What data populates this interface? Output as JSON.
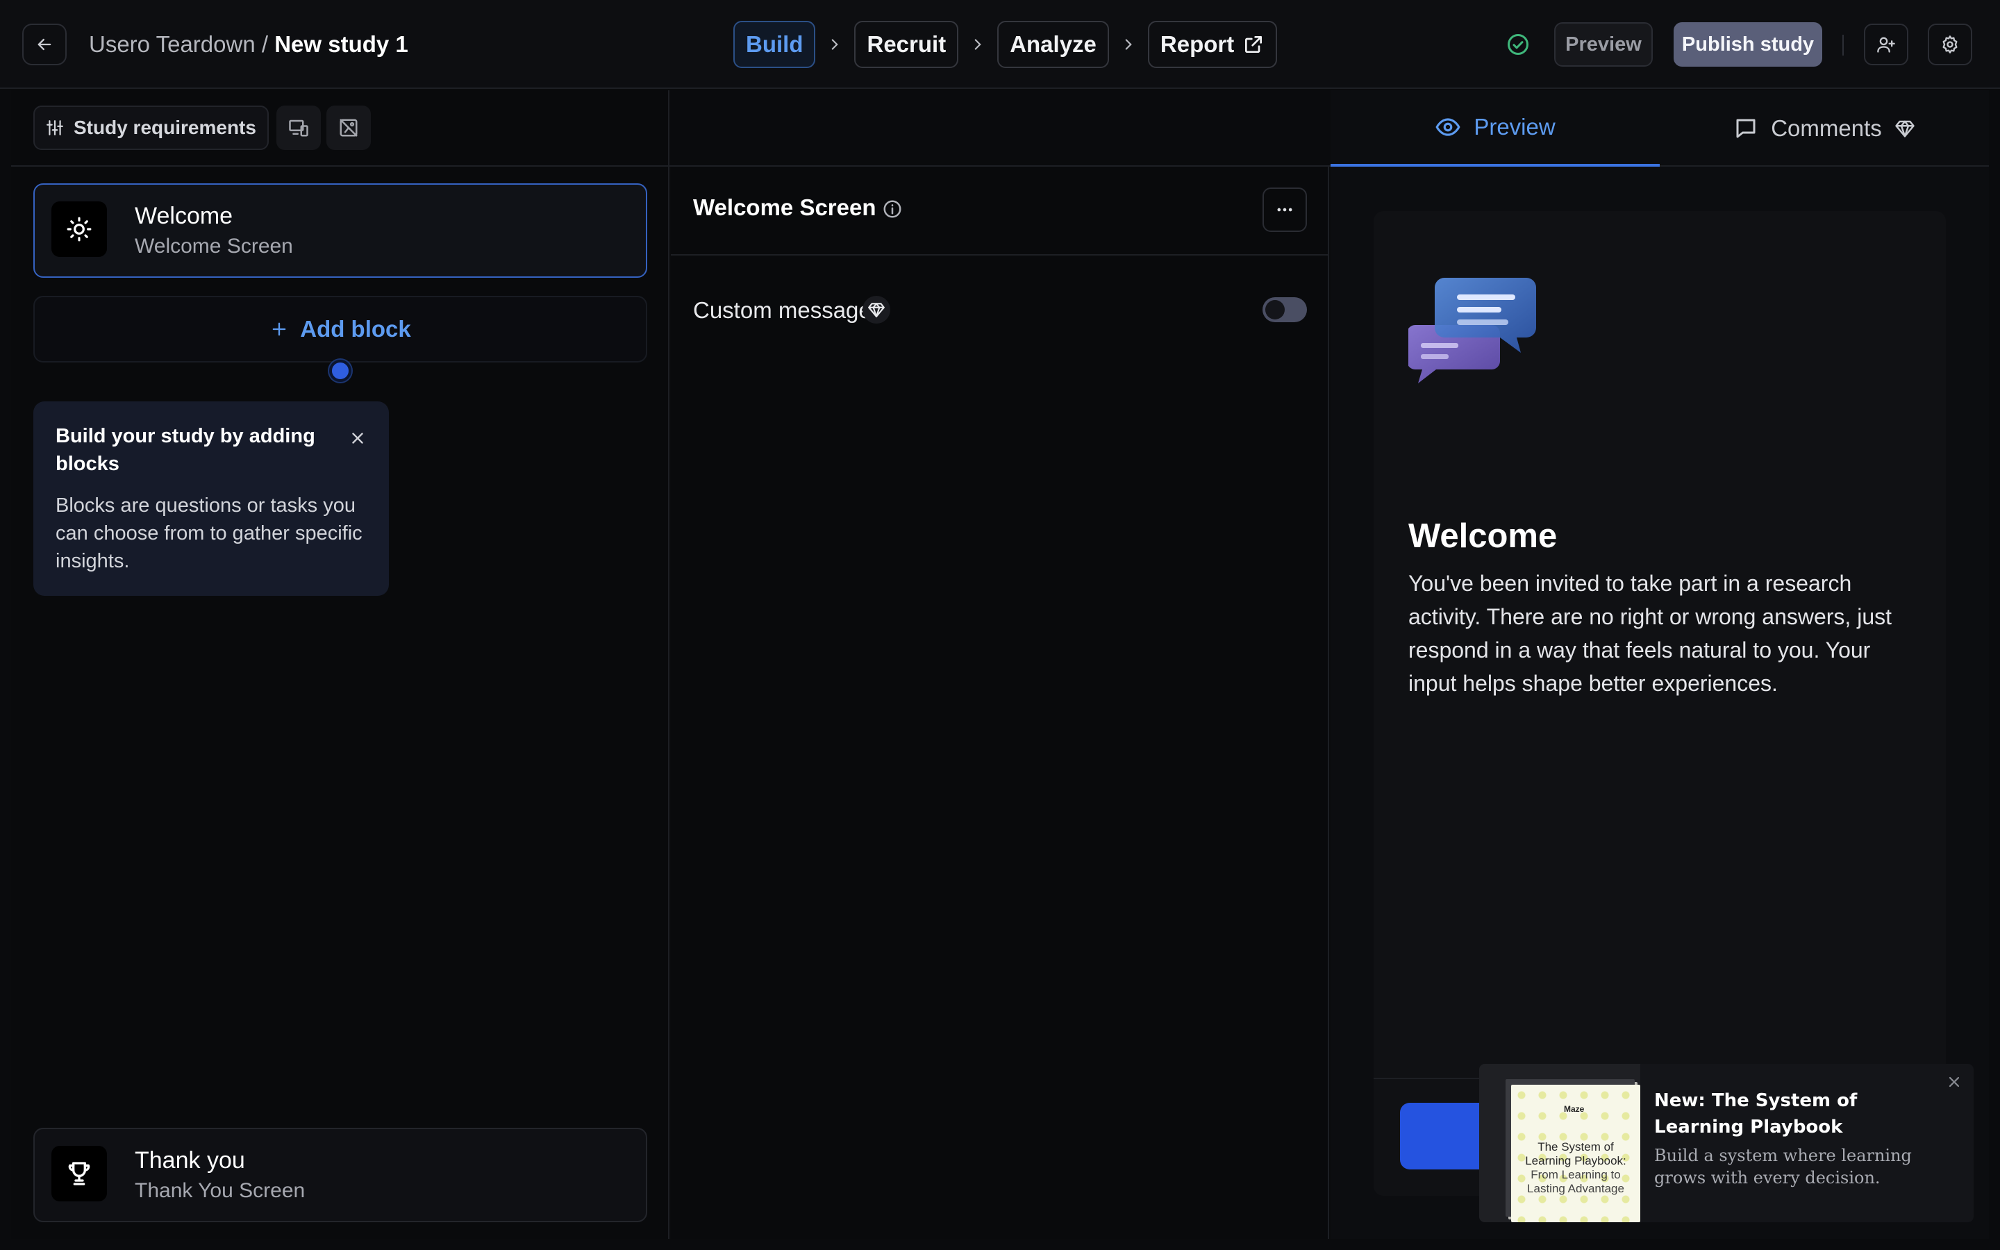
{
  "topbar": {
    "project": "Usero Teardown",
    "separator": "/",
    "study": "New study 1",
    "steps": [
      "Build",
      "Recruit",
      "Analyze",
      "Report"
    ],
    "active_step": "Build",
    "preview_label": "Preview",
    "publish_label": "Publish study"
  },
  "builder": {
    "requirements_label": "Study requirements",
    "blocks": [
      {
        "title": "Welcome",
        "subtitle": "Welcome Screen",
        "icon": "sun-icon",
        "selected": true
      }
    ],
    "add_block_label": "Add block",
    "tooltip": {
      "title": "Build your study by adding blocks",
      "body": "Blocks are questions or tasks you can choose from to gather specific insights."
    },
    "end_block": {
      "title": "Thank you",
      "subtitle": "Thank You Screen",
      "icon": "trophy-icon"
    }
  },
  "editor": {
    "title": "Welcome Screen",
    "custom_message_label": "Custom message",
    "custom_message_enabled": false
  },
  "preview_panel": {
    "tabs": [
      "Preview",
      "Comments"
    ],
    "active_tab": "Preview",
    "welcome_title": "Welcome",
    "welcome_text": "You've been invited to take part in a research activity. There are no right or wrong answers, just respond in a way that feels natural to you. Your input helps shape better experiences."
  },
  "promo": {
    "title": "New: The System of Learning Playbook",
    "body": "Build a system where learning grows with every decision.",
    "book_brand": "Maze",
    "book_title": "The System of Learning Playbook:",
    "book_subtitle": "From Learning to Lasting Advantage"
  },
  "colors": {
    "accent_blue": "#5d9bf0",
    "primary_button": "#2553e0",
    "success_green": "#3fb77b",
    "publish_button": "#5a5f79"
  }
}
